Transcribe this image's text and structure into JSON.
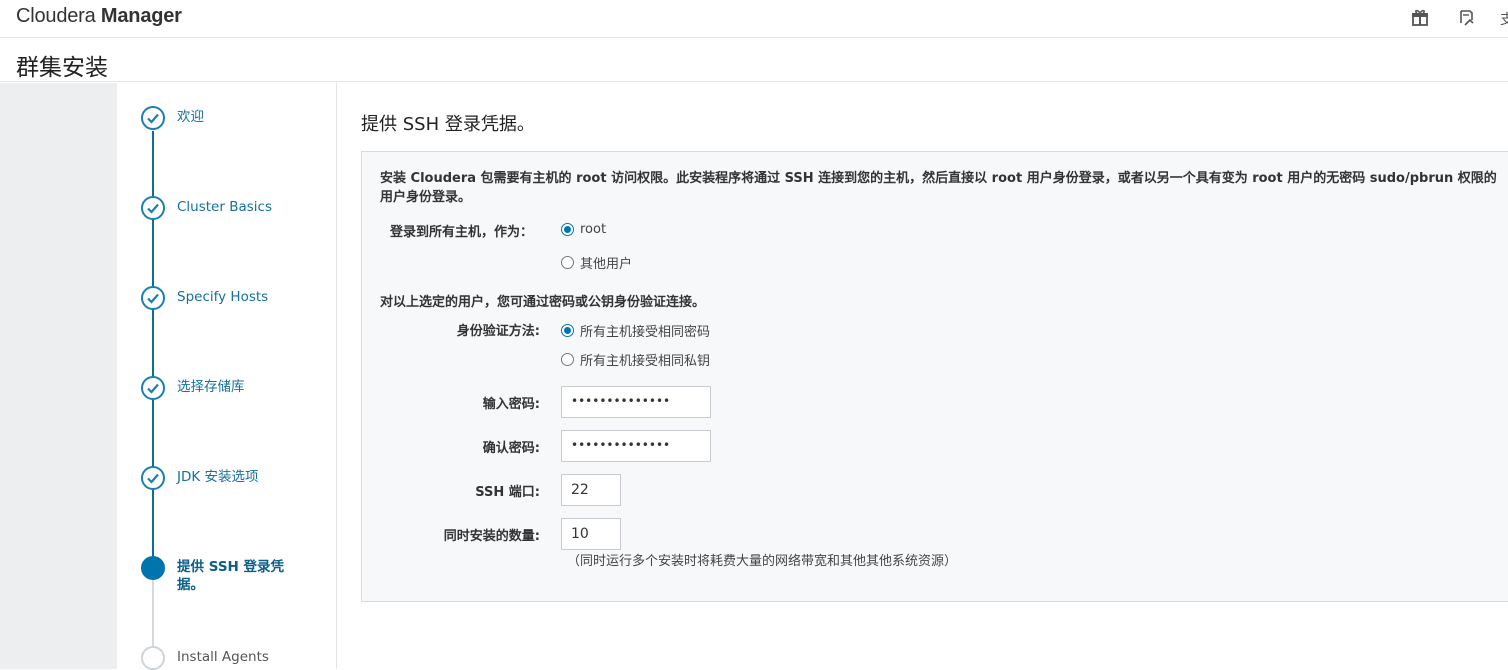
{
  "header": {
    "brand_prefix": "Cloudera",
    "brand_bold": "Manager",
    "cut_text": "支"
  },
  "page": {
    "title": "群集安装"
  },
  "steps": [
    {
      "label": "欢迎",
      "state": "done"
    },
    {
      "label": "Cluster Basics",
      "state": "done"
    },
    {
      "label": "Specify Hosts",
      "state": "done"
    },
    {
      "label": "选择存储库",
      "state": "done"
    },
    {
      "label": "JDK 安装选项",
      "state": "done"
    },
    {
      "label": "提供 SSH 登录凭据。",
      "state": "current"
    },
    {
      "label": "Install Agents",
      "state": "todo"
    }
  ],
  "content": {
    "heading": "提供 SSH 登录凭据。",
    "intro_line1": "安装 Cloudera 包需要有主机的 root 访问权限。此安装程序将通过 SSH 连接到您的主机，然后直接以 root 用户身份登录，或者以另一个具有变为 root 用户的无密码 sudo/pbrun 权限的",
    "intro_line2": "用户身份登录。",
    "login_as_label": "登录到所有主机，作为：",
    "login_options": [
      "root",
      "其他用户"
    ],
    "login_selected": "root",
    "auth_note": "对以上选定的用户，您可通过密码或公钥身份验证连接。",
    "auth_method_label": "身份验证方法:",
    "auth_options": [
      "所有主机接受相同密码",
      "所有主机接受相同私钥"
    ],
    "auth_selected": "所有主机接受相同密码",
    "password_label": "输入密码:",
    "password_value": "••••••••••••••",
    "confirm_label": "确认密码:",
    "confirm_value": "••••••••••••••",
    "ssh_port_label": "SSH 端口:",
    "ssh_port_value": "22",
    "parallel_label": "同时安装的数量:",
    "parallel_value": "10",
    "parallel_hint": "（同时运行多个安装时将耗费大量的网络带宽和其他其他系统资源）"
  },
  "colors": {
    "accent": "#0075ad",
    "step_link": "#15709e",
    "panel_bg": "#f7f8f9",
    "sidebar_gray": "#eceef0"
  },
  "icons": [
    "gift-icon",
    "notes-icon",
    "check-icon"
  ]
}
